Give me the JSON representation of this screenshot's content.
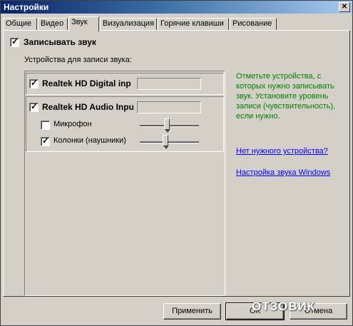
{
  "window": {
    "title": "Настройки",
    "close_glyph": "✕"
  },
  "tabs": [
    {
      "label": "Общие",
      "active": false
    },
    {
      "label": "Видео",
      "active": false
    },
    {
      "label": "Звук",
      "active": true
    },
    {
      "label": "Визуализация",
      "active": false
    },
    {
      "label": "Горячие клавиши",
      "active": false
    },
    {
      "label": "Рисование",
      "active": false
    }
  ],
  "record": {
    "label": "Записывать звук",
    "checked": true
  },
  "devices": {
    "section_label": "Устройства для записи звука:",
    "items": [
      {
        "label": "Realtek HD Digital inp",
        "checked": true
      },
      {
        "label": "Realtek HD Audio Inpu",
        "checked": true
      }
    ],
    "sub_items": [
      {
        "label": "Микрофон",
        "checked": false,
        "level": 0.45
      },
      {
        "label": "Колонки (наушники)",
        "checked": true,
        "level": 0.42
      }
    ]
  },
  "hint": "Отметьте устройства, с которых нужно записывать звук. Установите уровень записи (чувствительность), если нужно.",
  "links": {
    "no_device": "Нет нужного устройства?",
    "windows_sound": "Настройка звука Windows"
  },
  "buttons": {
    "apply": "Применить",
    "ok": "ОК",
    "cancel": "Отмена"
  },
  "watermark": "ОТЗОВИК",
  "colors": {
    "title_start": "#0a246a",
    "hint_green": "#008000",
    "link_blue": "#0000ff",
    "face": "#d4d0c8"
  }
}
